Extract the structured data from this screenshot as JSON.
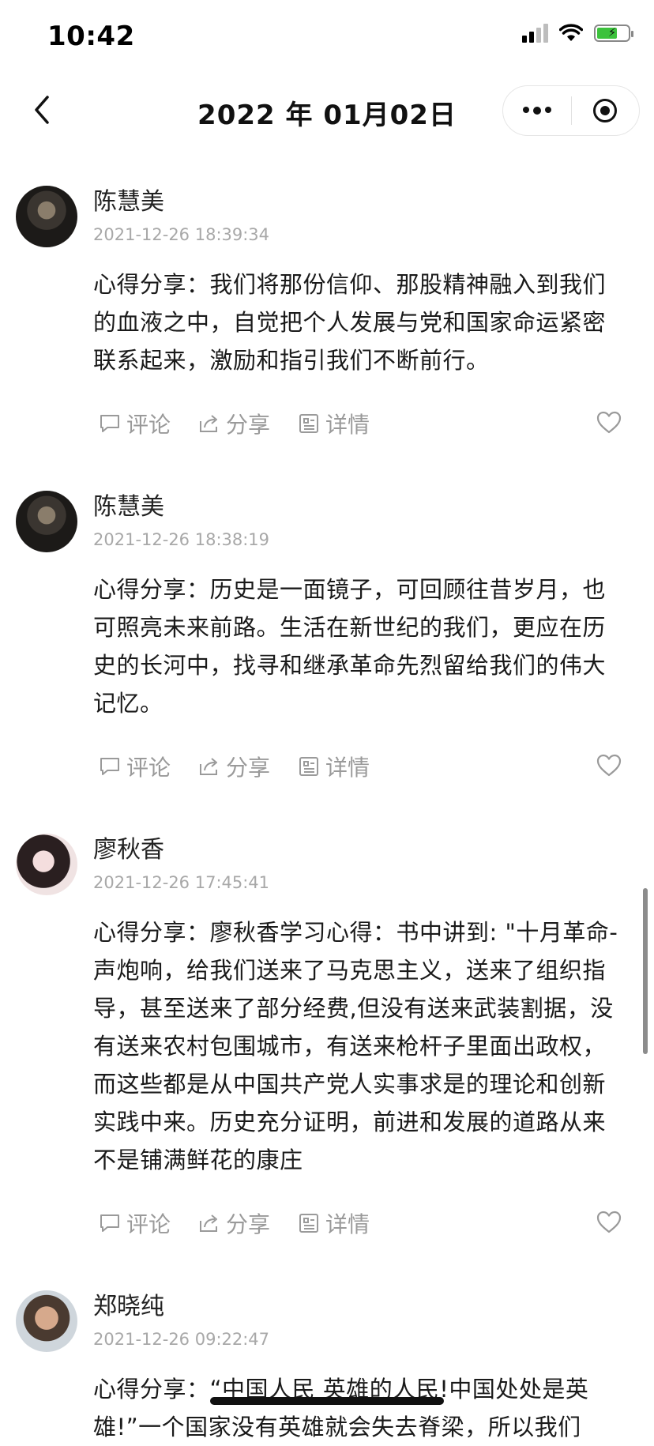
{
  "status_bar": {
    "time": "10:42"
  },
  "nav": {
    "title": "2022 年 01月02日"
  },
  "actions": {
    "comment": "评论",
    "share": "分享",
    "detail": "详情"
  },
  "posts": [
    {
      "author": "陈慧美",
      "time": "2021-12-26 18:39:34",
      "content": "心得分享：我们将那份信仰、那股精神融入到我们的血液之中，自觉把个人发展与党和国家命运紧密联系起来，激励和指引我们不断前行。"
    },
    {
      "author": "陈慧美",
      "time": "2021-12-26 18:38:19",
      "content": "心得分享：历史是一面镜子，可回顾往昔岁月，也可照亮未来前路。生活在新世纪的我们，更应在历史的长河中，找寻和继承革命先烈留给我们的伟大记忆。"
    },
    {
      "author": "廖秋香",
      "time": "2021-12-26 17:45:41",
      "content": "心得分享：廖秋香学习心得：书中讲到: \"十月革命-声炮响，给我们送来了马克思主义，送来了组织指导，甚至送来了部分经费,但没有送来武装割据，没有送来农村包围城市，有送来枪杆子里面出政权，而这些都是从中国共产党人实事求是的理论和创新实践中来。历史充分证明，前进和发展的道路从来不是铺满鲜花的康庄"
    },
    {
      "author": "郑晓纯",
      "time": "2021-12-26 09:22:47",
      "content": "心得分享：“中国人民 英雄的人民!中国处处是英雄!”一个国家没有英雄就会失去脊梁，所以我们"
    }
  ]
}
